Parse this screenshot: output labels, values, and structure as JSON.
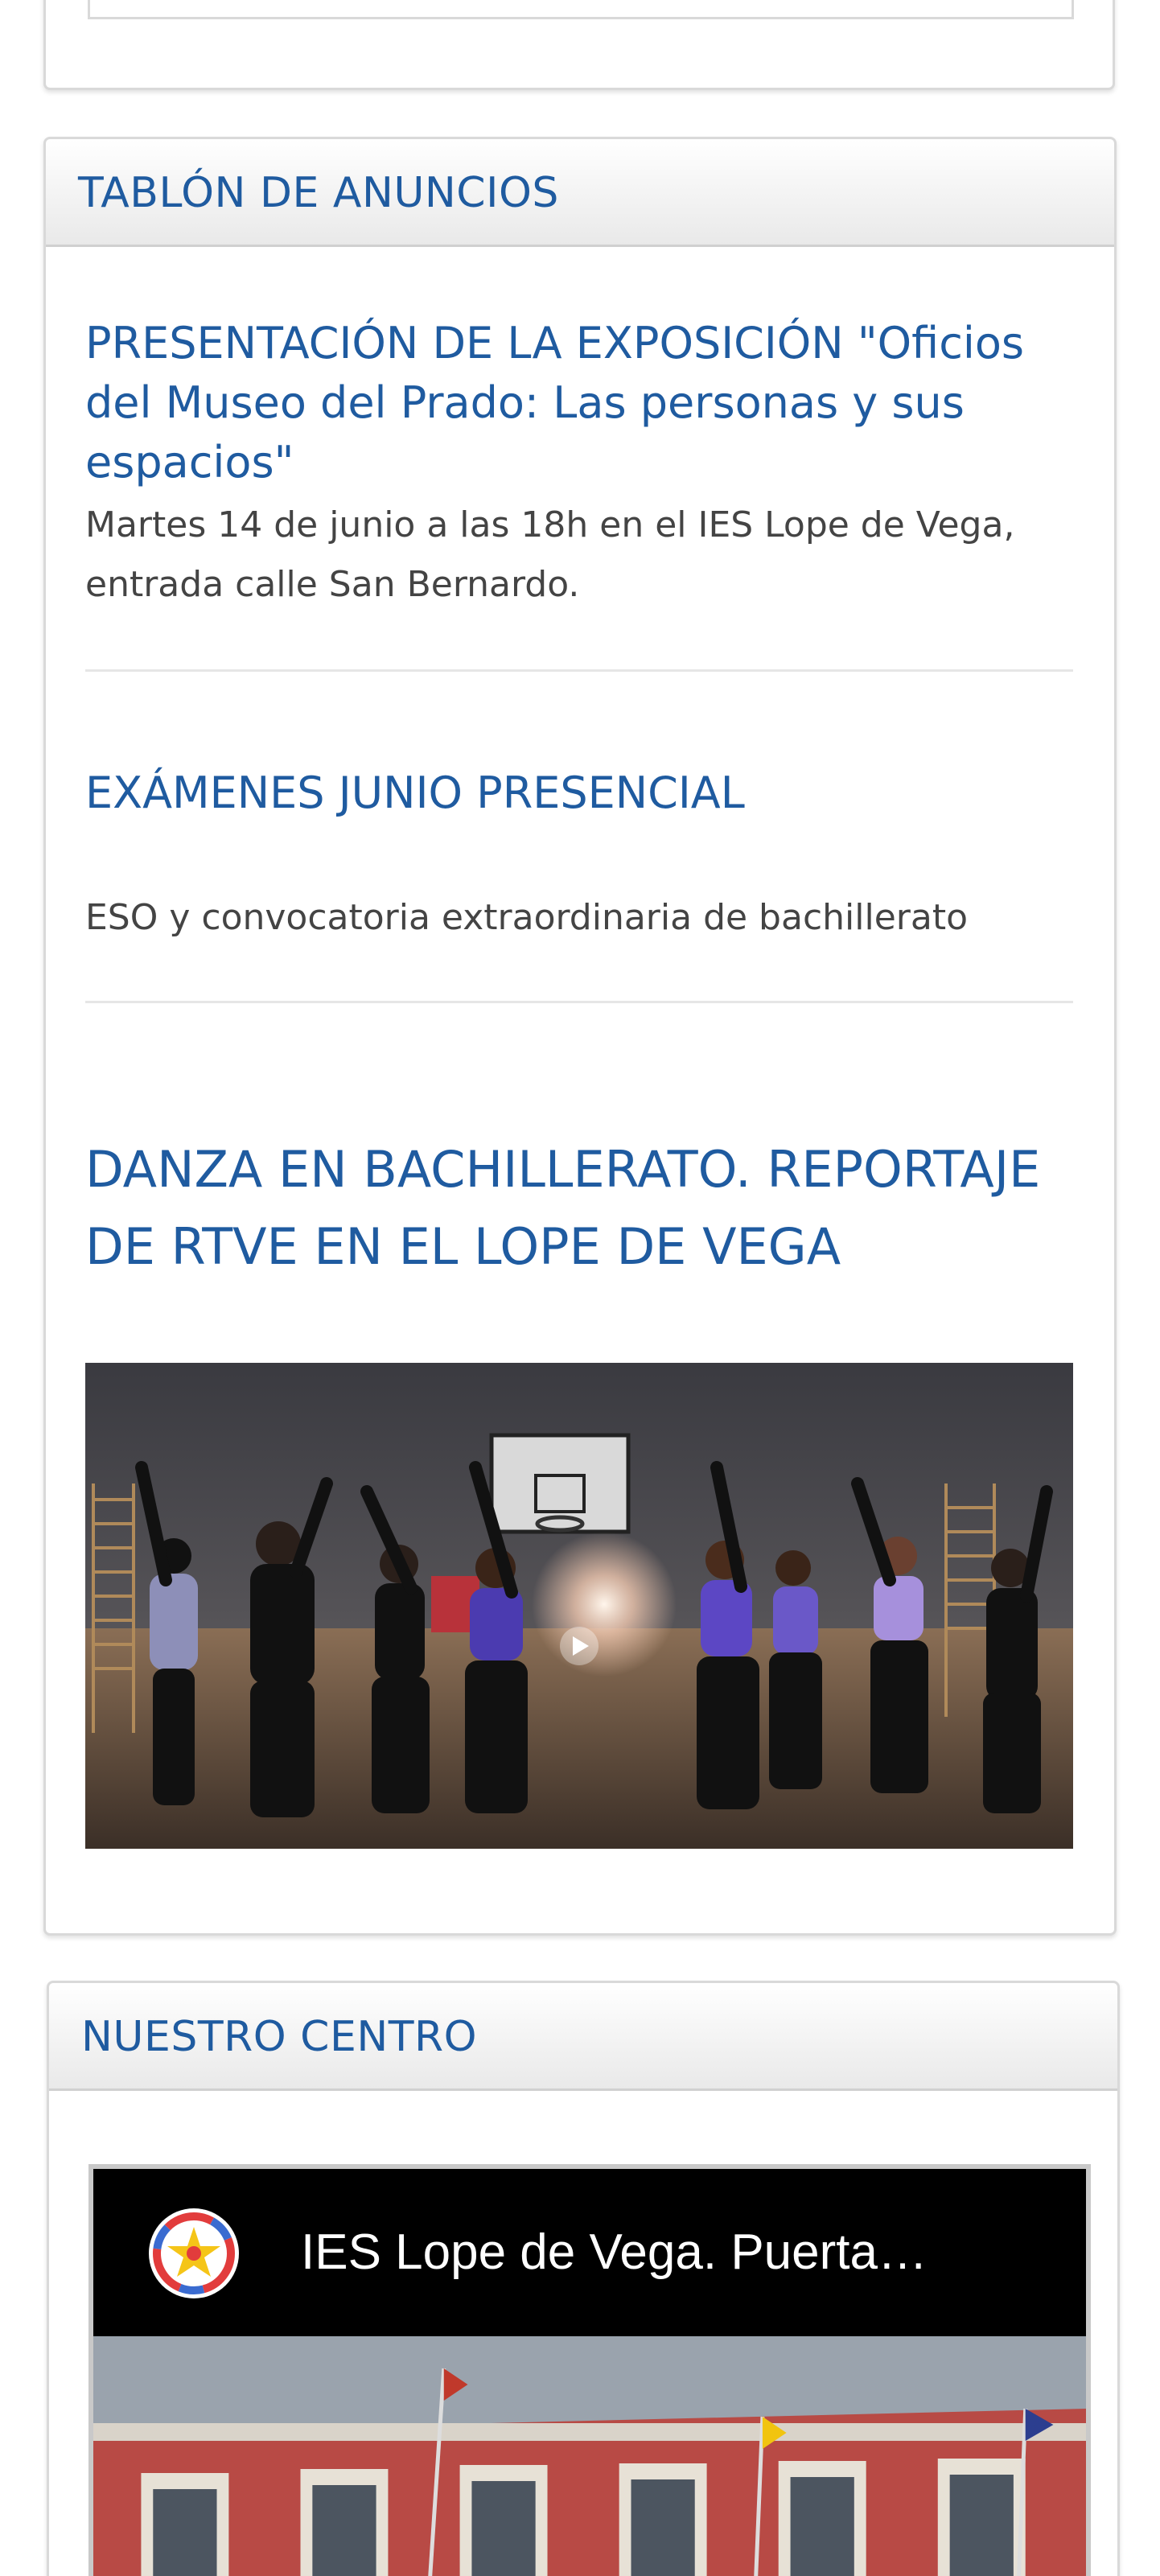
{
  "tablon": {
    "heading": "TABLÓN DE ANUNCIOS",
    "items": [
      {
        "title": "PRESENTACIÓN DE LA EXPOSICIÓN \"Oficios del Museo del Prado: Las personas y sus espacios\"",
        "text": "Martes 14 de junio a las 18h en el IES Lope de Vega, entrada calle San Bernardo."
      },
      {
        "title": "EXÁMENES JUNIO PRESENCIAL",
        "text": "ESO y convocatoria extraordinaria de bachillerato"
      },
      {
        "title": "DANZA EN BACHILLERATO. REPORTAJE DE RTVE EN EL LOPE DE VEGA"
      }
    ]
  },
  "centro": {
    "heading": "NUESTRO CENTRO",
    "video_title": "IES Lope de Vega. Puerta…"
  },
  "icons": {
    "video_play": "play-icon",
    "channel_logo": "channel-logo-icon"
  },
  "colors": {
    "accent": "#1f5ba0",
    "panel_border": "#d9d9d9"
  }
}
